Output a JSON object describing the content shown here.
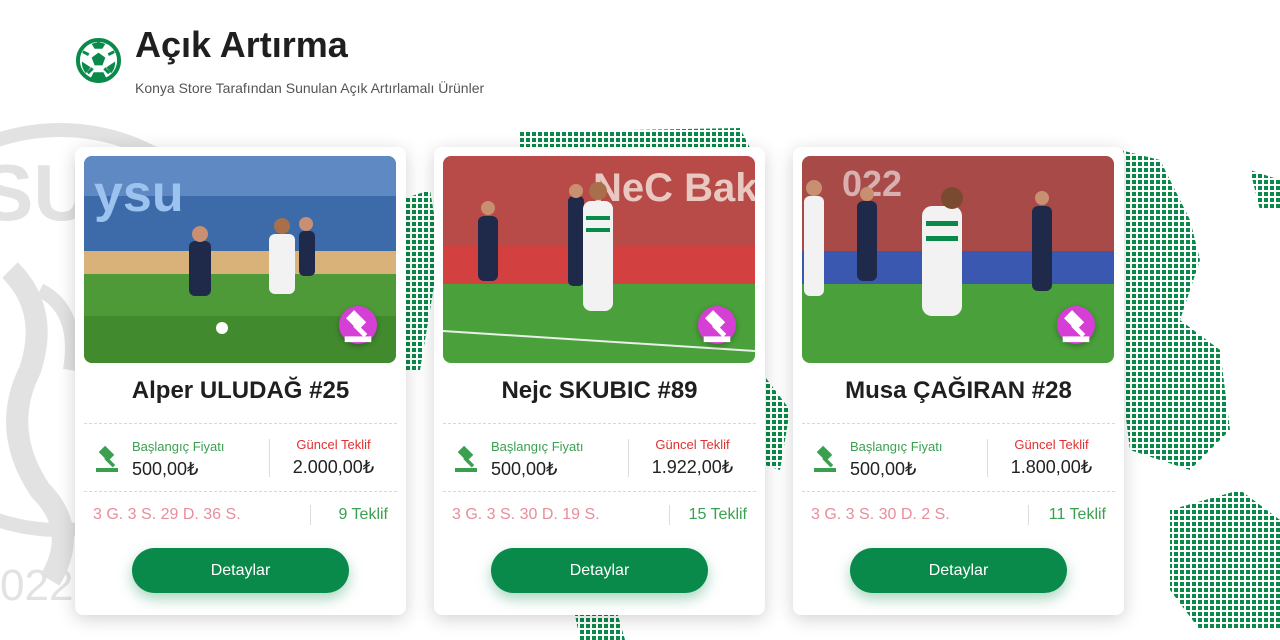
{
  "header": {
    "title": "Açık Artırma",
    "subtitle": "Konya Store Tarafından Sunulan Açık Artırlamalı Ürünler"
  },
  "background": {
    "crest_letters": "SU",
    "crest_year": "022"
  },
  "labels": {
    "start_price": "Başlangıç Fiyatı",
    "current_bid": "Güncel Teklif",
    "details_button": "Detaylar"
  },
  "cards": [
    {
      "name": "Alper ULUDAĞ #25",
      "start_price": "500,00₺",
      "current_bid": "2.000,00₺",
      "timer": "3 G. 3 S. 29 D. 36 S.",
      "bids": "9 Teklif",
      "photo_text": "ysu"
    },
    {
      "name": "Nejc SKUBIC #89",
      "start_price": "500,00₺",
      "current_bid": "1.922,00₺",
      "timer": "3 G. 3 S. 30 D. 19 S.",
      "bids": "15 Teklif",
      "photo_text": "NeC Bak"
    },
    {
      "name": "Musa ÇAĞIRAN #28",
      "start_price": "500,00₺",
      "current_bid": "1.800,00₺",
      "timer": "3 G. 3 S. 30 D. 2 S.",
      "bids": "11 Teklif",
      "photo_text": "022"
    }
  ],
  "colors": {
    "brand_green": "#0a8a4a",
    "label_green": "#3aa050",
    "label_red": "#e03030",
    "timer_pink": "#e88d9a",
    "badge_purple": "#d63fd6"
  },
  "icons": {
    "header": "football-icon",
    "photo_badge": "gavel-icon",
    "price_row": "gavel-icon"
  }
}
